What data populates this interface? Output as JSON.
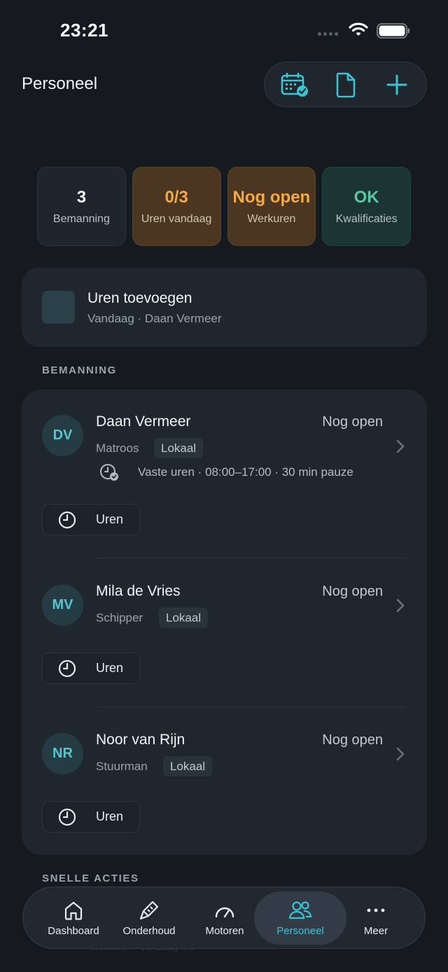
{
  "status_bar": {
    "time": "23:21"
  },
  "header": {
    "title": "Personeel"
  },
  "stats": [
    {
      "value": "3",
      "label": "Bemanning"
    },
    {
      "value": "0/3",
      "label": "Uren vandaag"
    },
    {
      "value": "Nog open",
      "label": "Werkuren"
    },
    {
      "value": "OK",
      "label": "Kwalificaties"
    }
  ],
  "quick_card": {
    "title": "Uren toevoegen",
    "subtitle": "Vandaag · Daan Vermeer"
  },
  "sections": {
    "crew": "BEMANNING",
    "quick_actions": "SNELLE ACTIES"
  },
  "crew": [
    {
      "initials": "DV",
      "name": "Daan Vermeer",
      "role": "Matroos",
      "tag": "Lokaal",
      "status": "Nog open",
      "schedule": "Vaste uren · 08:00–17:00 · 30 min pauze",
      "hours_button": "Uren"
    },
    {
      "initials": "MV",
      "name": "Mila de Vries",
      "role": "Schipper",
      "tag": "Lokaal",
      "status": "Nog open",
      "hours_button": "Uren"
    },
    {
      "initials": "NR",
      "name": "Noor van Rijn",
      "role": "Stuurman",
      "tag": "Lokaal",
      "status": "Nog open",
      "hours_button": "Uren"
    }
  ],
  "nav": [
    {
      "label": "Dashboard",
      "icon": "home-icon"
    },
    {
      "label": "Onderhoud",
      "icon": "wrench-icon"
    },
    {
      "label": "Motoren",
      "icon": "gauge-icon"
    },
    {
      "label": "Personeel",
      "icon": "people-icon",
      "active": true
    },
    {
      "label": "Meer",
      "icon": "more-icon"
    }
  ],
  "behind_nav_text": "Werkuren · vandaag 0/3",
  "colors": {
    "accent": "#3cc4d3",
    "warning": "#f3a94a",
    "ok": "#56c9a2",
    "background": "#151a20",
    "card": "#1f262e"
  }
}
